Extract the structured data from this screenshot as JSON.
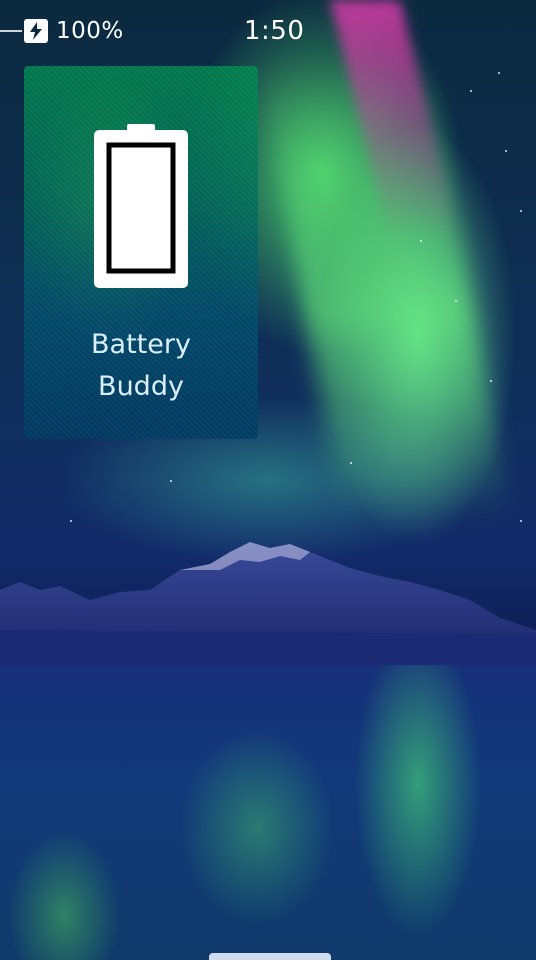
{
  "status_bar": {
    "battery_percent": "100%",
    "clock": "1:50",
    "charging_icon": "charging-bolt-icon"
  },
  "app_cover": {
    "title_line1": "Battery",
    "title_line2": "Buddy",
    "icon": "battery-icon",
    "battery_level_shown": 1.0
  },
  "colors": {
    "tile_green": "#00965a",
    "tile_blue": "#00506e",
    "text": "#ffffff"
  }
}
